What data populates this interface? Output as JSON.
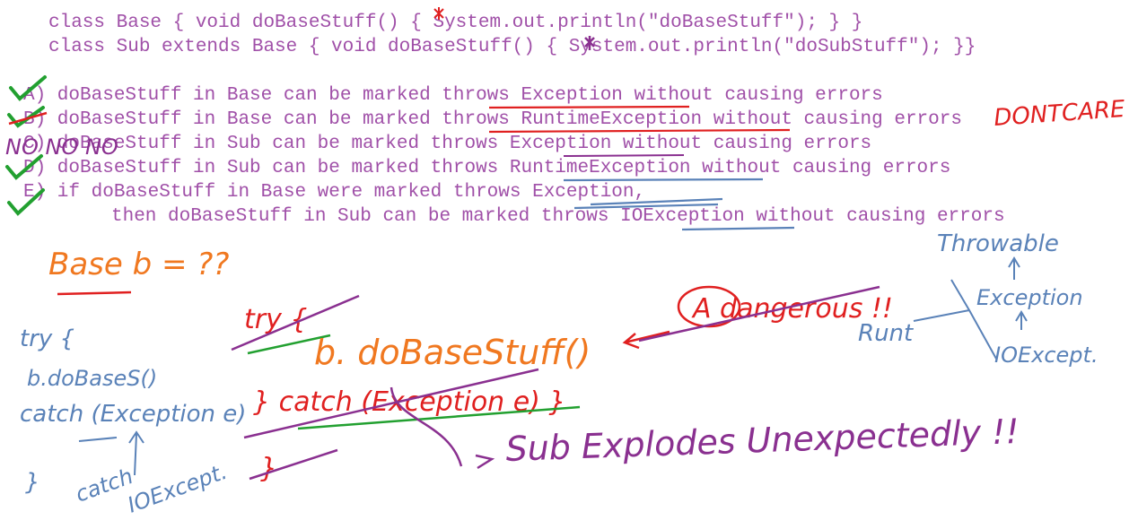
{
  "code": {
    "line1": "class Base { void doBaseStuff() { System.out.println(\"doBaseStuff\"); } }",
    "line2": "class Sub extends Base { void doBaseStuff() { System.out.println(\"doSubStuff\"); }}"
  },
  "options": [
    "A) doBaseStuff in Base can be marked throws Exception without causing errors",
    "B) doBaseStuff in Base can be marked throws RuntimeException without causing errors",
    "C) doBaseStuff in Sub can be marked throws Exception without causing errors",
    "D) doBaseStuff in Sub can be marked throws RuntimeException without causing errors",
    "E) if doBaseStuff in Base were marked throws Exception,",
    "then doBaseStuff in Sub can be marked throws IOException without causing errors"
  ],
  "annotations": {
    "dont_care": "DONTCARE",
    "no_no": "NO NO NO",
    "base_b": "Base  b = ??",
    "try_open": "try {",
    "call": "b. doBaseStuff()",
    "catch_line": "} catch (Exception e) }",
    "close_brace": "}",
    "a_dangerous": "A  dangerous !!",
    "sub_explodes": "Sub Explodes Unexpectedly !!",
    "left_try": "try {",
    "left_call": "b.doBaseS()",
    "left_catch": "catch (Exception e)",
    "left_close": "}",
    "left_catch2": "catch",
    "left_ioex": "IOExcept.",
    "throwable": "Throwable",
    "exception": "Exception",
    "runtime": "Runt",
    "ioexception": "IOExcept."
  },
  "colors": {
    "code_text": "#a050a8",
    "check_green": "#22a030",
    "red_ink": "#e02020",
    "orange_ink": "#f07820",
    "purple_ink": "#8a3090",
    "blue_ink": "#5a82b8"
  }
}
